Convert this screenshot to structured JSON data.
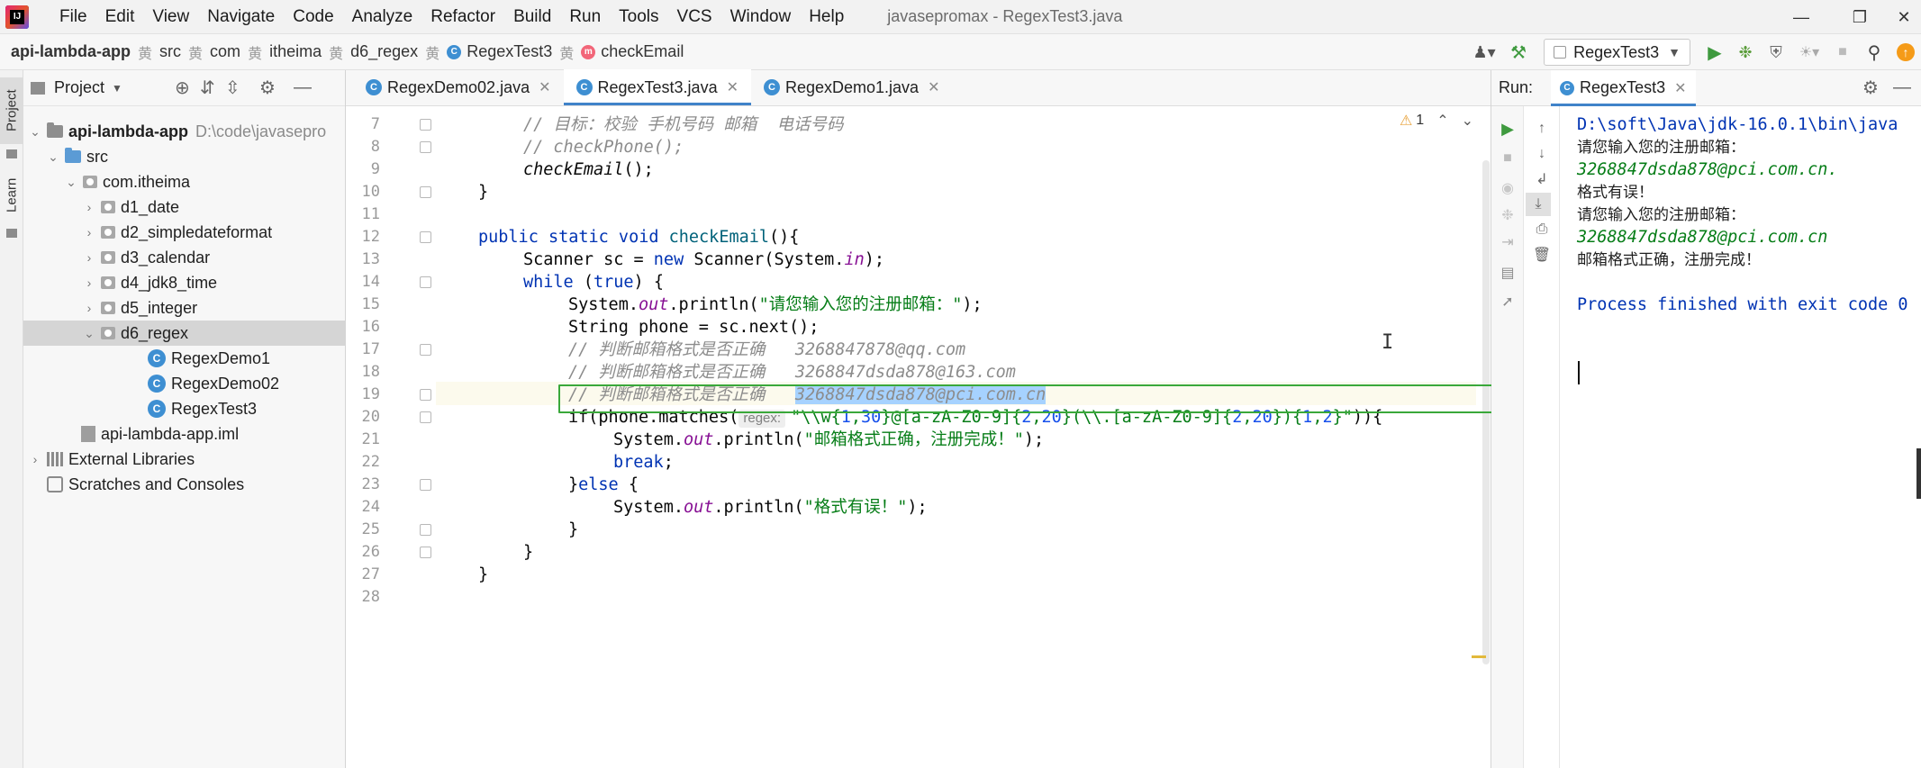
{
  "menubar": {
    "items": [
      "File",
      "Edit",
      "View",
      "Navigate",
      "Code",
      "Analyze",
      "Refactor",
      "Build",
      "Run",
      "Tools",
      "VCS",
      "Window",
      "Help"
    ],
    "title": "javasepromax - RegexTest3.java"
  },
  "breadcrumbs": [
    "api-lambda-app",
    "src",
    "com",
    "itheima",
    "d6_regex",
    "RegexTest3",
    "checkEmail"
  ],
  "run_config": "RegexTest3",
  "stripe": {
    "project": "Project",
    "learn": "Learn"
  },
  "project": {
    "title": "Project",
    "tree": [
      {
        "label": "api-lambda-app",
        "extra": "D:\\code\\javasepro"
      },
      {
        "label": "src"
      },
      {
        "label": "com.itheima"
      },
      {
        "label": "d1_date"
      },
      {
        "label": "d2_simpledateformat"
      },
      {
        "label": "d3_calendar"
      },
      {
        "label": "d4_jdk8_time"
      },
      {
        "label": "d5_integer"
      },
      {
        "label": "d6_regex"
      },
      {
        "label": "RegexDemo1"
      },
      {
        "label": "RegexDemo02"
      },
      {
        "label": "RegexTest3"
      },
      {
        "label": "api-lambda-app.iml"
      },
      {
        "label": "External Libraries"
      },
      {
        "label": "Scratches and Consoles"
      }
    ]
  },
  "tabs": [
    {
      "label": "RegexDemo02.java"
    },
    {
      "label": "RegexTest3.java"
    },
    {
      "label": "RegexDemo1.java"
    }
  ],
  "editor": {
    "warnings": "1",
    "line_numbers": [
      "7",
      "8",
      "9",
      "10",
      "11",
      "12",
      "13",
      "14",
      "15",
      "16",
      "17",
      "18",
      "19",
      "20",
      "21",
      "22",
      "23",
      "24",
      "25",
      "26",
      "27",
      "28"
    ],
    "code": {
      "l7": "// 目标：校验 手机号码 邮箱  电话号码",
      "l8": "// checkPhone();",
      "l9": "checkEmail",
      "l9b": "();",
      "l10": "}",
      "l12a": "public static void ",
      "l12b": "checkEmail",
      "l12c": "(){",
      "l13a": "Scanner sc = ",
      "l13b": "new",
      "l13c": " Scanner(System.",
      "l13d": "in",
      "l13e": ");",
      "l14a": "while",
      "l14b": " (",
      "l14c": "true",
      "l14d": ") {",
      "l15a": "System.",
      "l15b": "out",
      "l15c": ".println(",
      "l15d": "\"请您输入您的注册邮箱：\"",
      "l15e": ");",
      "l16": "String phone = sc.next();",
      "l17a": "// 判断邮箱格式是否正确   ",
      "l17b": "3268847878@qq.com",
      "l18a": "// 判断邮箱格式是否正确   ",
      "l18b": "3268847dsda878@163.com",
      "l19a": "// 判断邮箱格式是否正确   ",
      "l19b": "3268847dsda878@pci.com.cn",
      "l20a": "if(phone.matches(",
      "l20hint": "regex:",
      "l20b": "\"\\\\w{",
      "l20c": "1",
      "l20d": ",",
      "l20e": "30",
      "l20f": "}@[a-zA-Z0-9]{",
      "l20g": "2",
      "l20h": ",",
      "l20i": "20",
      "l20j": "}(\\\\.[a-zA-Z0-9]{",
      "l20k": "2",
      "l20l": ",",
      "l20m": "20",
      "l20n": "}){",
      "l20o": "1",
      "l20p": ",",
      "l20q": "2",
      "l20r": "}\"",
      "l20s": ")){",
      "l21a": "System.",
      "l21b": "out",
      "l21c": ".println(",
      "l21d": "\"邮箱格式正确，注册完成！\"",
      "l21e": ");",
      "l22": "break",
      "l22b": ";",
      "l23a": "}",
      "l23b": "else",
      "l23c": " {",
      "l24a": "System.",
      "l24b": "out",
      "l24c": ".println(",
      "l24d": "\"格式有误！\"",
      "l24e": ");",
      "l25": "}",
      "l26": "}",
      "l27": "}"
    }
  },
  "run": {
    "label": "Run:",
    "tab": "RegexTest3",
    "lines": [
      {
        "kind": "path",
        "text": "D:\\soft\\Java\\jdk-16.0.1\\bin\\java"
      },
      {
        "kind": "txt",
        "text": "请您输入您的注册邮箱："
      },
      {
        "kind": "inp",
        "text": "3268847dsda878@pci.com.cn."
      },
      {
        "kind": "txt",
        "text": "格式有误！"
      },
      {
        "kind": "txt",
        "text": "请您输入您的注册邮箱："
      },
      {
        "kind": "inp",
        "text": "3268847dsda878@pci.com.cn"
      },
      {
        "kind": "txt",
        "text": "邮箱格式正确，注册完成！"
      },
      {
        "kind": "blank",
        "text": ""
      },
      {
        "kind": "fin",
        "text": "Process finished with exit code 0"
      }
    ]
  },
  "colors": {
    "keyword": "#0033b3",
    "string": "#067d17",
    "field": "#871094",
    "comment": "#8c8c8c",
    "number": "#1750eb",
    "selection": "#a6d2ff",
    "inject_border": "#3aa83a"
  }
}
